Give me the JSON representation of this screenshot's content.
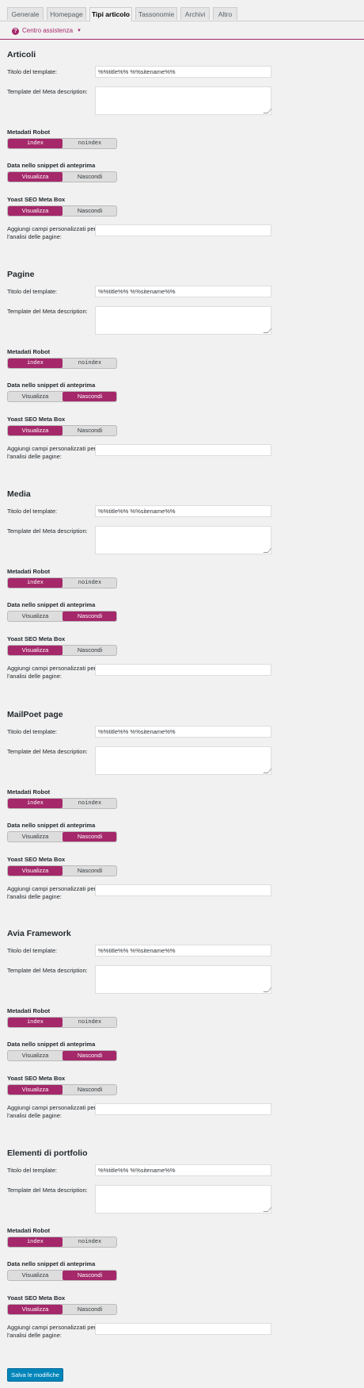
{
  "tabs": [
    "Generale",
    "Homepage",
    "Tipi articolo",
    "Tassonomie",
    "Archivi",
    "Altro"
  ],
  "active_tab": "Tipi articolo",
  "help": {
    "label": "Centro assistenza",
    "icon": "question-circle-icon",
    "caret_icon": "caret-down-icon"
  },
  "labels": {
    "title_template": "Titolo del template:",
    "meta_description": "Template del Meta description:",
    "robots": "Metadati Robot",
    "snippet_date": "Data nello snippet di anteprima",
    "metabox": "Yoast SEO Meta Box",
    "custom_fields_1": "Aggiungi campi personalizzati per",
    "custom_fields_2": "l'analisi delle pagine:"
  },
  "options": {
    "index": "index",
    "noindex": "noindex",
    "show": "Visualizza",
    "hide": "Nascondi"
  },
  "sections": [
    {
      "heading": "Articoli",
      "title_value": "%%title%% %%sitename%%",
      "robots_selected": "index",
      "date_selected": "Visualizza",
      "metabox_selected": "Visualizza"
    },
    {
      "heading": "Pagine",
      "title_value": "%%title%% %%sitename%%",
      "robots_selected": "index",
      "date_selected": "Nascondi",
      "metabox_selected": "Visualizza"
    },
    {
      "heading": "Media",
      "title_value": "%%title%% %%sitename%%",
      "robots_selected": "index",
      "date_selected": "Nascondi",
      "metabox_selected": "Visualizza"
    },
    {
      "heading": "MailPoet page",
      "title_value": "%%title%% %%sitename%%",
      "robots_selected": "index",
      "date_selected": "Nascondi",
      "metabox_selected": "Visualizza"
    },
    {
      "heading": "Avia Framework",
      "title_value": "%%title%% %%sitename%%",
      "robots_selected": "index",
      "date_selected": "Nascondi",
      "metabox_selected": "Visualizza"
    },
    {
      "heading": "Elementi di portfolio",
      "title_value": "%%title%% %%sitename%%",
      "robots_selected": "index",
      "date_selected": "Nascondi",
      "metabox_selected": "Visualizza"
    }
  ],
  "save_button": "Salva le modifiche",
  "colors": {
    "accent": "#a4286a",
    "primary_button": "#0085ba",
    "background": "#f1f1f1"
  }
}
